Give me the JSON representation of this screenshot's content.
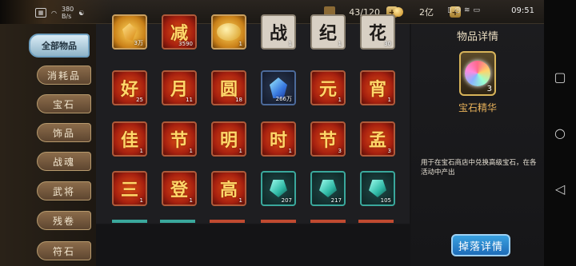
{
  "status": {
    "net_speed": "380",
    "net_unit": "B/s",
    "bag_count": "43/120",
    "coin_amount": "2亿",
    "time": "09:51"
  },
  "menu": {
    "items": [
      {
        "label": "全部物品",
        "active": true
      },
      {
        "label": "消耗品",
        "active": false
      },
      {
        "label": "宝石",
        "active": false
      },
      {
        "label": "饰品",
        "active": false
      },
      {
        "label": "战魂",
        "active": false
      },
      {
        "label": "武将",
        "active": false
      },
      {
        "label": "残卷",
        "active": false
      },
      {
        "label": "符石",
        "active": false
      }
    ]
  },
  "grid": {
    "row0": [
      {
        "type": "gold",
        "glyph": "",
        "count": "3万"
      },
      {
        "type": "red",
        "glyph": "减",
        "count": "3590"
      },
      {
        "type": "gold",
        "glyph": "",
        "count": "1"
      },
      {
        "type": "ink",
        "glyph": "战",
        "count": "1"
      },
      {
        "type": "ink",
        "glyph": "纪",
        "count": "1"
      },
      {
        "type": "ink",
        "glyph": "花",
        "count": "30"
      }
    ],
    "row1": [
      {
        "type": "red",
        "glyph": "好",
        "count": "25"
      },
      {
        "type": "red",
        "glyph": "月",
        "count": "11"
      },
      {
        "type": "red",
        "glyph": "圆",
        "count": "18"
      },
      {
        "type": "gem",
        "glyph": "",
        "count": "266万"
      },
      {
        "type": "red",
        "glyph": "元",
        "count": "1"
      },
      {
        "type": "red",
        "glyph": "宵",
        "count": "1"
      }
    ],
    "row2": [
      {
        "type": "red",
        "glyph": "佳",
        "count": "1"
      },
      {
        "type": "red",
        "glyph": "节",
        "count": "1"
      },
      {
        "type": "red",
        "glyph": "明",
        "count": "1"
      },
      {
        "type": "red",
        "glyph": "时",
        "count": "1"
      },
      {
        "type": "red",
        "glyph": "节",
        "count": "3"
      },
      {
        "type": "red",
        "glyph": "孟",
        "count": "3"
      }
    ],
    "row3": [
      {
        "type": "red",
        "glyph": "三",
        "count": "1"
      },
      {
        "type": "red",
        "glyph": "登",
        "count": "1"
      },
      {
        "type": "red",
        "glyph": "高",
        "count": "1"
      },
      {
        "type": "jade",
        "glyph": "",
        "count": "207"
      },
      {
        "type": "jade",
        "glyph": "",
        "count": "217"
      },
      {
        "type": "jade",
        "glyph": "",
        "count": "105"
      }
    ]
  },
  "detail": {
    "title": "物品详情",
    "item_count": "3",
    "item_name": "宝石精华",
    "description": "用于在宝石商店中兑换高级宝石，在各活动中产出",
    "drop_button": "掉落详情"
  }
}
